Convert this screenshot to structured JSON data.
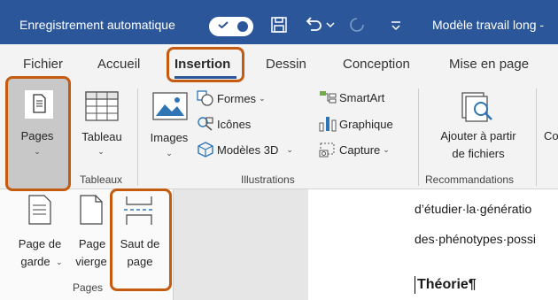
{
  "titlebar": {
    "autosave_label": "Enregistrement automatique",
    "document_title": "Modèle travail long -"
  },
  "tabs": [
    {
      "label": "Fichier"
    },
    {
      "label": "Accueil"
    },
    {
      "label": "Insertion",
      "active": true
    },
    {
      "label": "Dessin"
    },
    {
      "label": "Conception"
    },
    {
      "label": "Mise en page"
    }
  ],
  "ribbon": {
    "pages": {
      "label": "Pages"
    },
    "tableaux": {
      "table_label": "Tableau",
      "group_label": "Tableaux"
    },
    "illustrations": {
      "images_label": "Images",
      "formes_label": "Formes",
      "icones_label": "Icônes",
      "modeles3d_label": "Modèles 3D",
      "smartart_label": "SmartArt",
      "graphique_label": "Graphique",
      "capture_label": "Capture",
      "group_label": "Illustrations"
    },
    "recommandations": {
      "add_line1": "Ajouter à partir",
      "add_line2": "de fichiers",
      "group_label": "Recommandations"
    },
    "cut_label": "Co"
  },
  "pages_dropdown": {
    "page_garde_line1": "Page de",
    "page_garde_line2": "garde",
    "page_vierge_line1": "Page",
    "page_vierge_line2": "vierge",
    "saut_line1": "Saut de",
    "saut_line2": "page",
    "group_label": "Pages"
  },
  "document": {
    "line1": "d’étudier·la·génératio",
    "line2": "des·phénotypes·possi",
    "heading": "Théorie¶"
  },
  "colors": {
    "titlebar": "#2b579a",
    "ribbon": "#f3f3f3",
    "highlight": "#c55a11"
  }
}
